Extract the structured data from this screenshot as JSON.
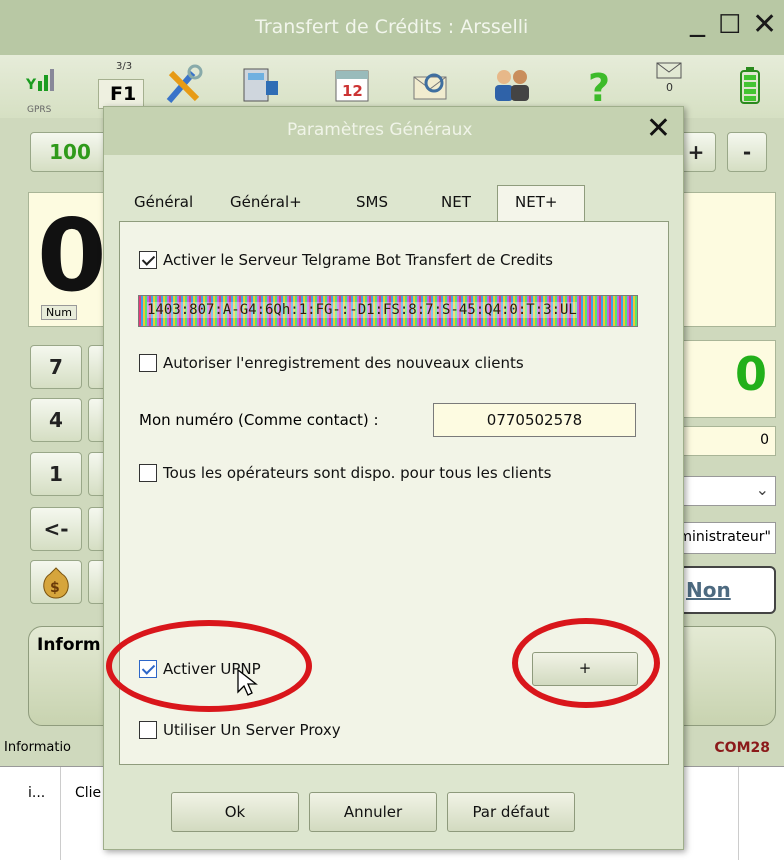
{
  "window": {
    "title": "Transfert de Crédits : Arsselli",
    "minimize": "_",
    "maximize": "☐",
    "close": "✕"
  },
  "toolbar": {
    "signal_label": "GPRS",
    "page_counter": "3/3",
    "f1_label": "F1",
    "mail_badge": "0"
  },
  "background": {
    "amount_label": "100",
    "big_digit": "0",
    "num_badge": "Num",
    "keys": [
      "7",
      "4",
      "1",
      "<-"
    ],
    "plus_label": "+",
    "minus_label": "-",
    "right_total": "0",
    "right_small": "0",
    "admin_text": "ministrateur\"",
    "non_label": "Non",
    "info_button": "Inform",
    "status_left": "Informatio",
    "status_right": "COM28",
    "table_col1": "i...",
    "table_col2": "Clie"
  },
  "dialog": {
    "title": "Paramètres Généraux",
    "close": "✕",
    "tabs": [
      "Général",
      "Général+",
      "SMS",
      "NET",
      "NET+"
    ],
    "active_tab": "NET+",
    "telegram_bot_label": "Activer le Serveur Telgrame Bot Transfert de Credits",
    "telegram_bot_checked": true,
    "token_value": "1403:807:A-G4:6Qh:1:FG-:-D1:FS:8:7:S-45:Q4:0:T:3:UL",
    "allow_new_clients_label": "Autoriser l'enregistrement des nouveaux clients",
    "allow_new_clients_checked": false,
    "my_number_label": "Mon numéro (Comme contact) :",
    "my_number_value": "0770502578",
    "all_operators_label": "Tous les opérateurs sont dispo. pour tous les clients",
    "all_operators_checked": false,
    "upnp_label": "Activer UPNP",
    "upnp_checked": true,
    "upnp_plus": "+",
    "proxy_label": "Utiliser Un Server Proxy",
    "proxy_checked": false,
    "ok_label": "Ok",
    "cancel_label": "Annuler",
    "default_label": "Par défaut"
  },
  "colors": {
    "highlight_ring": "#d9161b",
    "accent_green": "#22b01a",
    "dark_red": "#8b1a1a"
  }
}
